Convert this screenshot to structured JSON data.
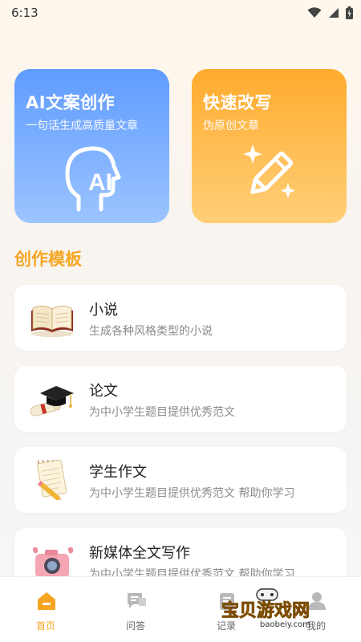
{
  "status": {
    "time": "6:13"
  },
  "cards": {
    "ai": {
      "title": "AI文案创作",
      "subtitle": "一句话生成高质量文章",
      "icon": "ai-head-icon",
      "color": "#5f9cff"
    },
    "rewrite": {
      "title": "快速改写",
      "subtitle": "伪原创文章",
      "icon": "magic-pen-icon",
      "color": "#ffab2e"
    }
  },
  "section": {
    "title": "创作模板"
  },
  "templates": [
    {
      "title": "小说",
      "desc": "生成各种风格类型的小说",
      "icon": "open-book-icon"
    },
    {
      "title": "论文",
      "desc": "为中小学生题目提供优秀范文",
      "icon": "graduation-cap-icon"
    },
    {
      "title": "学生作文",
      "desc": "为中小学生题目提供优秀范文 帮助你学习",
      "icon": "notepad-pen-icon"
    },
    {
      "title": "新媒体全文写作",
      "desc": "为中小学生题目提供优秀范文 帮助你学习",
      "icon": "camera-icon"
    }
  ],
  "tabs": [
    {
      "label": "首页",
      "icon": "home-icon",
      "active": true
    },
    {
      "label": "问答",
      "icon": "chat-icon",
      "active": false
    },
    {
      "label": "记录",
      "icon": "record-icon",
      "active": false
    },
    {
      "label": "我的",
      "icon": "profile-icon",
      "active": false
    }
  ],
  "watermark": {
    "brand": "宝贝游戏网",
    "url": "baobeiy.com"
  },
  "colors": {
    "accent": "#f6a623",
    "blue": "#5f9cff",
    "orange": "#ffab2e"
  }
}
